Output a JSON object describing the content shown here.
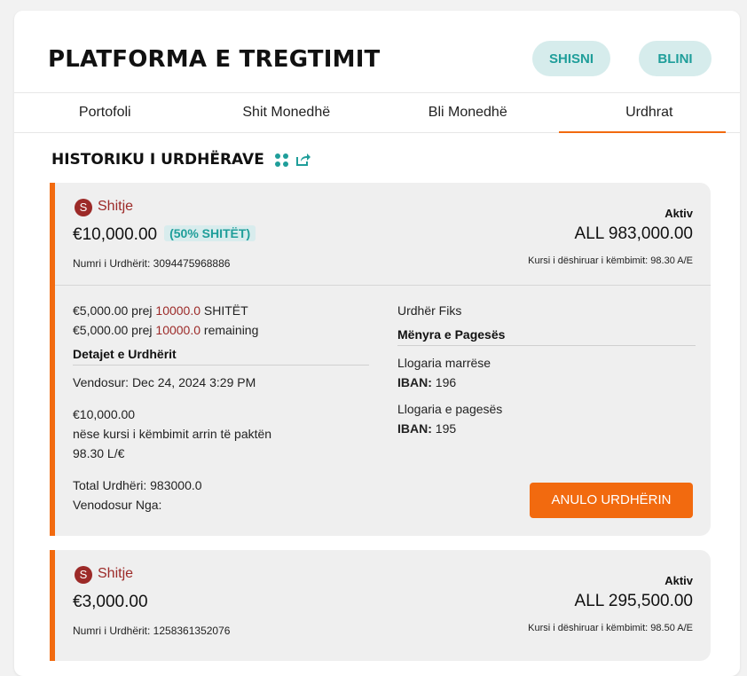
{
  "app": {
    "title": "PLATFORMA E TREGTIMIT",
    "sell_button": "SHISNI",
    "buy_button": "BLINI"
  },
  "tabs": [
    {
      "label": "Portofoli",
      "active": false
    },
    {
      "label": "Shit Monedhë",
      "active": false
    },
    {
      "label": "Bli Monedhë",
      "active": false
    },
    {
      "label": "Urdhrat",
      "active": true
    }
  ],
  "section": {
    "title": "HISTORIKU I URDHËRAVE",
    "icons": [
      "grid-dots-icon",
      "share-icon"
    ]
  },
  "colors": {
    "accent": "#f26a0f",
    "teal": "#1f9e9a",
    "sell_red": "#9c2a28"
  },
  "orders": [
    {
      "side_badge": "S",
      "side_label": "Shitje",
      "amount": "€10,000.00",
      "sold_badge": "(50% SHITËT)",
      "order_number": "Numri i Urdhërit: 3094475968886",
      "status": "Aktiv",
      "total_all": "ALL 983,000.00",
      "desired_rate": "Kursi i dëshiruar i këmbimit: 98.30 A/E",
      "sold_line": {
        "prefix": "€5,000.00 prej ",
        "total": "10000.0",
        "suffix": " SHITËT"
      },
      "remaining_line": {
        "prefix": "€5,000.00 prej ",
        "total": "10000.0",
        "suffix": " remaining"
      },
      "details_heading": "Detajet e Urdhërit",
      "placed": "Vendosur: Dec 24, 2024 3:29 PM",
      "condition_amount": "€10,000.00",
      "condition_text": "nëse kursi i këmbimit arrin të paktën",
      "condition_rate": "98.30 L/€",
      "total_order": "Total Urdhëri: 983000.0",
      "placed_by": "Venodosur Nga:",
      "order_type": "Urdhër Fiks",
      "payment_heading": "Mënyra e Pagesës",
      "receiving_account_label": "Llogaria marrëse",
      "receiving_iban_label": "IBAN:",
      "receiving_iban": "196",
      "paying_account_label": "Llogaria e pagesës",
      "paying_iban_label": "IBAN:",
      "paying_iban": "195",
      "cancel_button": "ANULO URDHËRIN"
    },
    {
      "side_badge": "S",
      "side_label": "Shitje",
      "amount": "€3,000.00",
      "order_number": "Numri i Urdhërit: 1258361352076",
      "status": "Aktiv",
      "total_all": "ALL 295,500.00",
      "desired_rate": "Kursi i dëshiruar i këmbimit: 98.50 A/E"
    }
  ]
}
